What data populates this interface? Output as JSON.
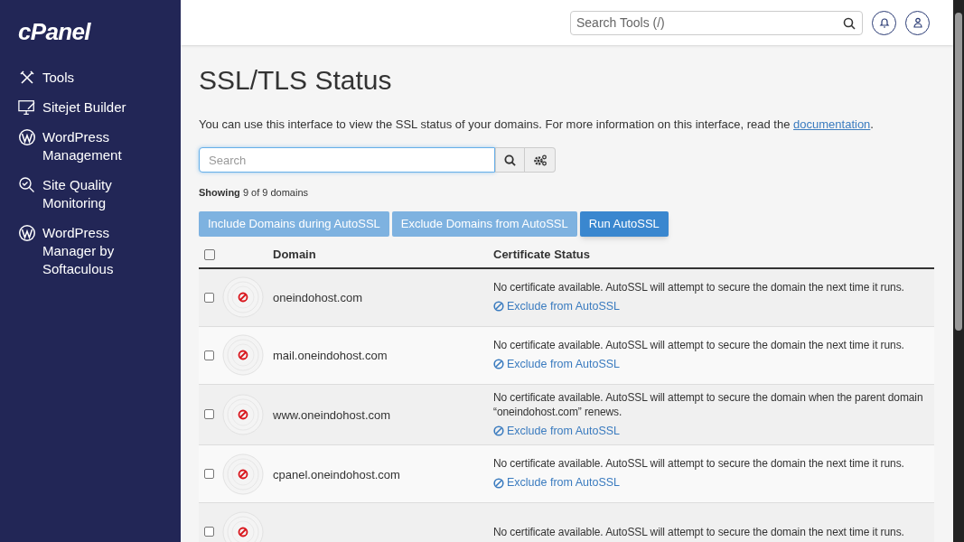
{
  "logo": "cPanel",
  "sidebar": {
    "items": [
      {
        "label": "Tools",
        "kind": "tools"
      },
      {
        "label": "Sitejet Builder",
        "kind": "sitejet"
      },
      {
        "label": "WordPress Management",
        "kind": "wordpress"
      },
      {
        "label": "Site Quality Monitoring",
        "kind": "quality"
      },
      {
        "label": "WordPress Manager by Softaculous",
        "kind": "wordpress"
      }
    ]
  },
  "header": {
    "search": {
      "placeholder": "Search Tools (/)"
    }
  },
  "page": {
    "title": "SSL/TLS Status",
    "intro": {
      "text": "You can use this interface to view the SSL status of your domains. For more information on this interface, read the",
      "link": "documentation",
      "end": "."
    },
    "search": {
      "placeholder": "Search"
    },
    "showing": "**Showing** 9 of 9 domains",
    "buttons": [
      {
        "label": "Include Domains during AutoSSL",
        "disabled": true
      },
      {
        "label": "Exclude Domains from AutoSSL",
        "disabled": true
      },
      {
        "label": "Run AutoSSL",
        "disabled": false
      }
    ],
    "table": {
      "select_all": {
        "checked": false
      },
      "columns": [
        "Domain",
        "Certificate Status"
      ],
      "rows": [
        {
          "checked": false,
          "domain": "oneindohost.com",
          "status": "No certificate available. AutoSSL will attempt to secure the domain the next time it runs.",
          "action": "Exclude from AutoSSL"
        },
        {
          "checked": false,
          "domain": "mail.oneindohost.com",
          "status": "No certificate available. AutoSSL will attempt to secure the domain the next time it runs.",
          "action": "Exclude from AutoSSL"
        },
        {
          "checked": false,
          "domain": "www.oneindohost.com",
          "status": "No certificate available. AutoSSL will attempt to secure the domain when the parent domain “oneindohost.com” renews.",
          "action": "Exclude from AutoSSL"
        },
        {
          "checked": false,
          "domain": "cpanel.oneindohost.com",
          "status": "No certificate available. AutoSSL will attempt to secure the domain the next time it runs.",
          "action": "Exclude from AutoSSL"
        },
        {
          "checked": false,
          "status": "No certificate available. AutoSSL will attempt to secure the domain the next time it runs."
        }
      ]
    }
  }
}
